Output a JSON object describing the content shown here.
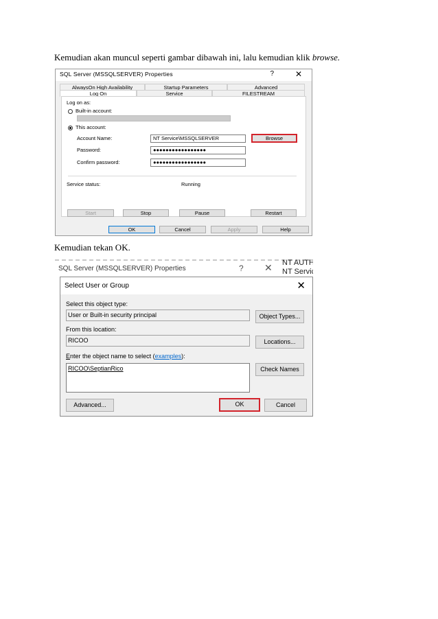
{
  "doc": {
    "para1_main": "Kemudian akan muncul seperti gambar dibawah ini, lalu kemudian klik ",
    "para1_em": "browse.",
    "para2": "Kemudian tekan OK."
  },
  "shot1": {
    "title": "SQL Server (MSSQLSERVER) Properties",
    "help": "?",
    "close": "✕",
    "tabs_row1": [
      "AlwaysOn High Availability",
      "Startup Parameters",
      "Advanced"
    ],
    "tabs_row2": [
      "Log On",
      "Service",
      "FILESTREAM"
    ],
    "log_on_as": "Log on as:",
    "builtin_account": "Built-in account:",
    "this_account": "This account:",
    "account_name_label": "Account Name:",
    "account_name_value": "NT Service\\MSSQLSERVER",
    "password_label": "Password:",
    "password_value": "●●●●●●●●●●●●●●●●●",
    "confirm_label": "Confirm password:",
    "confirm_value": "●●●●●●●●●●●●●●●●●",
    "browse": "Browse",
    "service_status_label": "Service status:",
    "service_status_value": "Running",
    "start": "Start",
    "stop": "Stop",
    "pause": "Pause",
    "restart": "Restart",
    "ok": "OK",
    "cancel": "Cancel",
    "apply": "Apply",
    "help_btn": "Help"
  },
  "shot2": {
    "bg_title": "SQL Server (MSSQLSERVER) Properties",
    "bg_help": "?",
    "bg_close": "✕",
    "bg_right1": "NT AUTHC",
    "bg_right2": "NT Service'",
    "title": "Select User or Group",
    "close": "✕",
    "object_type_label": "Select this object type:",
    "object_type_value": "User or Built-in security principal",
    "object_types_btn": "Object Types...",
    "location_label": "From this location:",
    "location_value": "RICOO",
    "locations_btn": "Locations...",
    "enter_label_e": "E",
    "enter_label_rest": "nter the object name to select (",
    "examples": "examples",
    "enter_label_end": "):",
    "object_name_value": "RICOO\\SeptianRico",
    "check_names_btn": "Check Names",
    "advanced_btn": "Advanced...",
    "ok_btn": "OK",
    "cancel_btn": "Cancel"
  }
}
